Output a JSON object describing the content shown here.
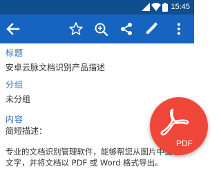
{
  "status_bar": {
    "time": "15:45",
    "icons": [
      "signal-icon",
      "wifi-icon",
      "battery-icon"
    ]
  },
  "toolbar": {
    "actions": [
      "back-arrow-icon",
      "star-icon",
      "zoom-search-icon",
      "share-icon",
      "edit-pencil-icon",
      "more-vert-icon"
    ]
  },
  "document": {
    "title_label": "标题",
    "title_value": "安卓云脉文档识别产品描述",
    "group_label": "分组",
    "group_value": "未分组",
    "content_label": "内容",
    "content_intro": "简短描述：",
    "content_line1": "专业的文档识别管理软件，能够帮您从图片中提取",
    "content_line2": "文字，并将文档以 PDF 或 Word 格式导出。"
  },
  "fab": {
    "label": "PDF",
    "icon": "pdf-icon"
  },
  "colors": {
    "status_bar": "#0f4f8f",
    "toolbar": "#1565c0",
    "section_label": "#2f6fb0",
    "fab": "#ef473a"
  }
}
